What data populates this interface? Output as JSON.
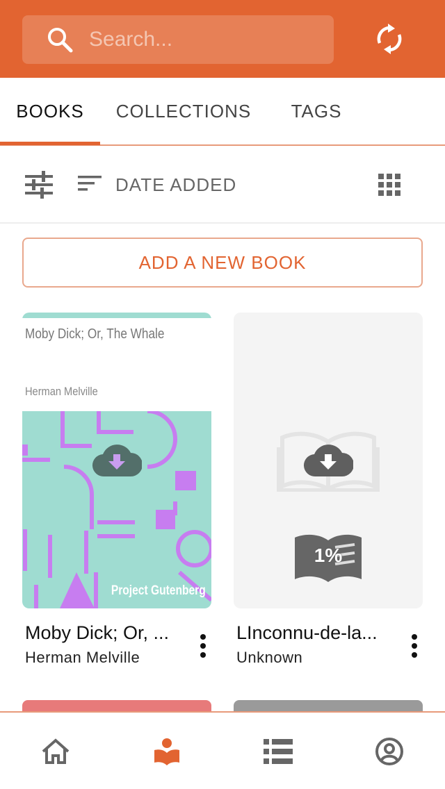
{
  "search": {
    "placeholder": "Search..."
  },
  "tabs": [
    {
      "label": "BOOKS",
      "active": true
    },
    {
      "label": "COLLECTIONS",
      "active": false
    },
    {
      "label": "TAGS",
      "active": false
    }
  ],
  "toolbar": {
    "sort_label": "DATE ADDED"
  },
  "add_book": {
    "label": "ADD A NEW BOOK"
  },
  "books": [
    {
      "title": "Moby Dick; Or, ...",
      "author": "Herman Melville",
      "cover_title": "Moby Dick; Or, The Whale",
      "cover_author": "Herman Melville",
      "cover_publisher": "Project Gutenberg",
      "icon": "cloud-download-icon"
    },
    {
      "title": "LInconnu-de-la...",
      "author": "Unknown",
      "progress_label": "1%",
      "icon": "cloud-download-icon"
    }
  ],
  "bottom_nav": [
    {
      "icon": "home-icon",
      "active": false
    },
    {
      "icon": "library-icon",
      "active": true
    },
    {
      "icon": "list-icon",
      "active": false
    },
    {
      "icon": "account-icon",
      "active": false
    }
  ],
  "colors": {
    "accent": "#e26431",
    "cover_teal": "#9fdcd1",
    "cover_purple": "#c77df0"
  }
}
